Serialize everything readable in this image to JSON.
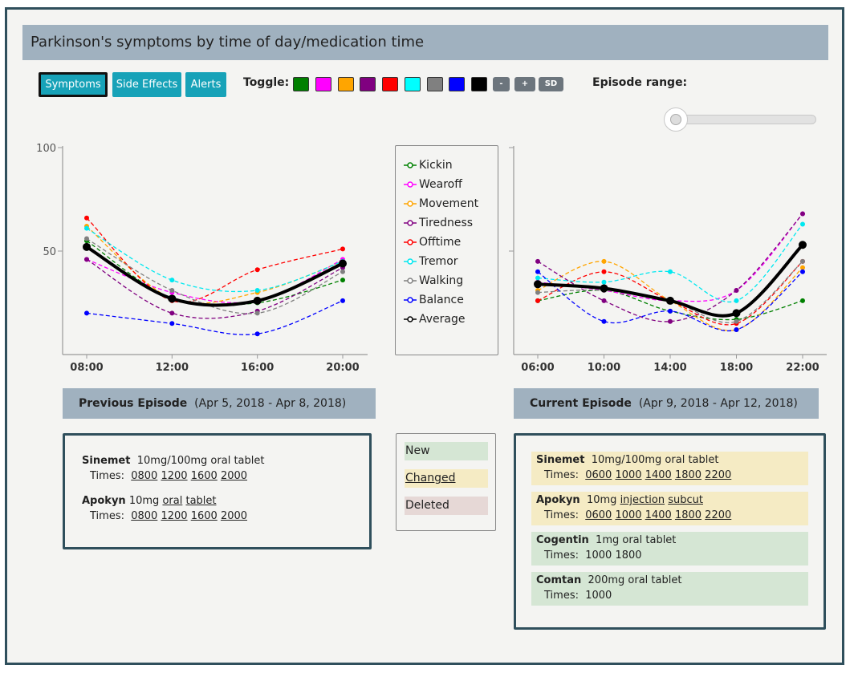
{
  "title": "Parkinson's symptoms by time of day/medication time",
  "toolbar": {
    "buttons": [
      "Symptoms",
      "Side Effects",
      "Alerts"
    ],
    "toggle_label": "Toggle:",
    "swatches": [
      {
        "name": "green-toggle",
        "color": "#008000"
      },
      {
        "name": "magenta-toggle",
        "color": "#ff00ff"
      },
      {
        "name": "orange-toggle",
        "color": "#ffa500"
      },
      {
        "name": "purple-toggle",
        "color": "#800080"
      },
      {
        "name": "red-toggle",
        "color": "#ff0000"
      },
      {
        "name": "cyan-toggle",
        "color": "#00ffff"
      },
      {
        "name": "gray-toggle",
        "color": "#808080"
      },
      {
        "name": "blue-toggle",
        "color": "#0000ff"
      },
      {
        "name": "black-toggle",
        "color": "#000000"
      }
    ],
    "minus_label": "-",
    "plus_label": "+",
    "sd_label": "SD",
    "episode_range_label": "Episode range:",
    "episode_range_value": 0
  },
  "legend": [
    {
      "name": "Kickin",
      "color": "#008000"
    },
    {
      "name": "Wearoff",
      "color": "#ff00ff"
    },
    {
      "name": "Movement",
      "color": "#ffa500"
    },
    {
      "name": "Tiredness",
      "color": "#800080"
    },
    {
      "name": "Offtime",
      "color": "#ff0000"
    },
    {
      "name": "Tremor",
      "color": "#00e8f0"
    },
    {
      "name": "Walking",
      "color": "#808080"
    },
    {
      "name": "Balance",
      "color": "#0000ff"
    },
    {
      "name": "Average",
      "color": "#000000"
    }
  ],
  "chart_data": [
    {
      "type": "line",
      "x": [
        "08:00",
        "12:00",
        "16:00",
        "20:00"
      ],
      "ylim": [
        0,
        100
      ],
      "yticks": [
        "100",
        "50"
      ],
      "series": [
        {
          "name": "Kickin",
          "color": "#008000",
          "values": [
            55,
            27,
            25,
            36
          ]
        },
        {
          "name": "Wearoff",
          "color": "#ff00ff",
          "values": [
            46,
            30,
            26,
            46
          ]
        },
        {
          "name": "Movement",
          "color": "#ffa500",
          "values": [
            62,
            27,
            30,
            45
          ]
        },
        {
          "name": "Tiredness",
          "color": "#800080",
          "values": [
            46,
            20,
            21,
            42
          ]
        },
        {
          "name": "Offtime",
          "color": "#ff0000",
          "values": [
            66,
            26,
            41,
            51
          ]
        },
        {
          "name": "Tremor",
          "color": "#00e8f0",
          "values": [
            61,
            36,
            31,
            45
          ]
        },
        {
          "name": "Walking",
          "color": "#808080",
          "values": [
            56,
            31,
            20,
            40
          ]
        },
        {
          "name": "Balance",
          "color": "#0000ff",
          "values": [
            20,
            15,
            10,
            26
          ]
        },
        {
          "name": "Average",
          "color": "#000000",
          "values": [
            52,
            27,
            26,
            44
          ]
        }
      ]
    },
    {
      "type": "line",
      "x": [
        "06:00",
        "10:00",
        "14:00",
        "18:00",
        "22:00"
      ],
      "ylim": [
        0,
        100
      ],
      "yticks": [],
      "series": [
        {
          "name": "Kickin",
          "color": "#008000",
          "values": [
            26,
            31,
            21,
            17,
            26
          ]
        },
        {
          "name": "Wearoff",
          "color": "#ff00ff",
          "values": [
            35,
            31,
            26,
            31,
            68
          ]
        },
        {
          "name": "Movement",
          "color": "#ffa500",
          "values": [
            31,
            45,
            26,
            12,
            42
          ]
        },
        {
          "name": "Tiredness",
          "color": "#800080",
          "values": [
            45,
            26,
            16,
            31,
            68
          ]
        },
        {
          "name": "Offtime",
          "color": "#ff0000",
          "values": [
            26,
            40,
            26,
            15,
            45
          ]
        },
        {
          "name": "Tremor",
          "color": "#00e8f0",
          "values": [
            37,
            35,
            40,
            26,
            63
          ]
        },
        {
          "name": "Walking",
          "color": "#808080",
          "values": [
            30,
            31,
            26,
            16,
            45
          ]
        },
        {
          "name": "Balance",
          "color": "#0000ff",
          "values": [
            40,
            16,
            21,
            12,
            40
          ]
        },
        {
          "name": "Average",
          "color": "#000000",
          "values": [
            34,
            32,
            26,
            20,
            53
          ]
        }
      ]
    }
  ],
  "previous_episode": {
    "label": "Previous Episode",
    "range": "(Apr 5, 2018 - Apr 8, 2018)",
    "meds": [
      {
        "name": "Sinemet",
        "desc": "10mg/100mg oral tablet",
        "times_label": "Times:",
        "times": [
          "0800",
          "1200",
          "1600",
          "2000"
        ]
      },
      {
        "name": "Apokyn",
        "dose": "10mg",
        "route": "oral",
        "form": "tablet",
        "times_label": "Times:",
        "times": [
          "0800",
          "1200",
          "1600",
          "2000"
        ]
      }
    ]
  },
  "key": {
    "new": "New",
    "changed": "Changed",
    "deleted": "Deleted"
  },
  "current_episode": {
    "label": "Current Episode",
    "range": "(Apr 9, 2018 - Apr 12, 2018)",
    "meds": [
      {
        "name": "Sinemet",
        "desc": "10mg/100mg oral tablet",
        "times_label": "Times:",
        "times": [
          "0600",
          "1000",
          "1400",
          "1800",
          "2200"
        ],
        "status": "changed"
      },
      {
        "name": "Apokyn",
        "dose": "10mg",
        "route": "injection",
        "form": "subcut",
        "times_label": "Times:",
        "times": [
          "0600",
          "1000",
          "1400",
          "1800",
          "2200"
        ],
        "status": "changed"
      },
      {
        "name": "Cogentin",
        "desc": "1mg oral tablet",
        "times_label": "Times:",
        "times_text": "1000 1800",
        "status": "new"
      },
      {
        "name": "Comtan",
        "desc": "200mg oral tablet",
        "times_label": "Times:",
        "times_text": "1000",
        "status": "new"
      }
    ]
  },
  "colors": {
    "changed": "#f5ebc4",
    "new": "#d5e6d4",
    "deleted": "#e6d8d6",
    "accent": "#17a2b8",
    "header": "#a0b1bf",
    "border": "#2f4f5c"
  }
}
